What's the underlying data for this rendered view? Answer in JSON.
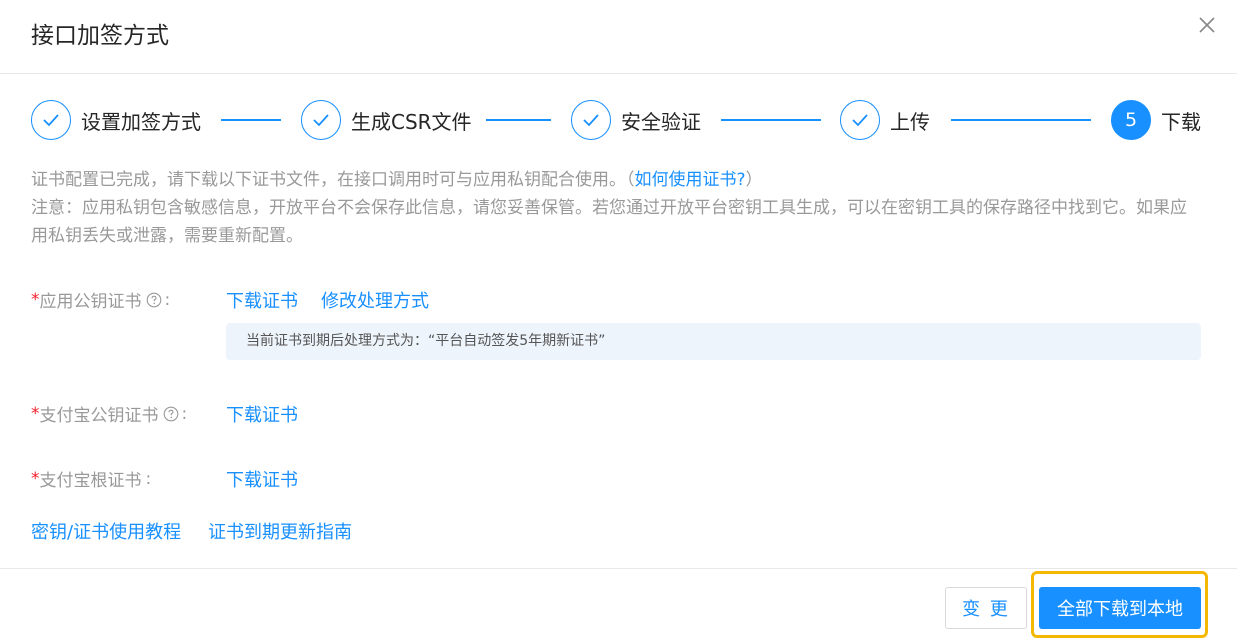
{
  "dialog": {
    "title": "接口加签方式"
  },
  "steps": [
    {
      "label": "设置加签方式",
      "status": "done"
    },
    {
      "label": "生成CSR文件",
      "status": "done"
    },
    {
      "label": "安全验证",
      "status": "done"
    },
    {
      "label": "上传",
      "status": "done"
    },
    {
      "label": "下载",
      "status": "active",
      "number": "5"
    }
  ],
  "notice": {
    "line1": "证书配置已完成，请下载以下证书文件，在接口调用时可与应用私钥配合使用。（",
    "help_link": "如何使用证书?",
    "line1_end": "）",
    "line2": "注意：应用私钥包含敏感信息，开放平台不会保存此信息，请您妥善保管。若您通过开放平台密钥工具生成，可以在密钥工具的保存路径中找到它。如果应用私钥丢失或泄露，需要重新配置。"
  },
  "fields": {
    "app_cert": {
      "required_mark": "*",
      "label": "应用公钥证书",
      "colon": ":",
      "download": "下载证书",
      "modify": "修改处理方式",
      "info": "当前证书到期后处理方式为：“平台自动签发5年期新证书”"
    },
    "alipay_cert": {
      "required_mark": "*",
      "label": "支付宝公钥证书",
      "colon": ":",
      "download": "下载证书"
    },
    "root_cert": {
      "required_mark": "*",
      "label": "支付宝根证书",
      "colon": ":",
      "download": "下载证书"
    }
  },
  "links": {
    "tutorial": "密钥/证书使用教程",
    "guide": "证书到期更新指南"
  },
  "footer": {
    "change_label": "变 更",
    "download_all_label": "全部下载到本地"
  },
  "colors": {
    "primary": "#1890ff",
    "highlight": "#f5b800",
    "required": "#f5222d"
  }
}
